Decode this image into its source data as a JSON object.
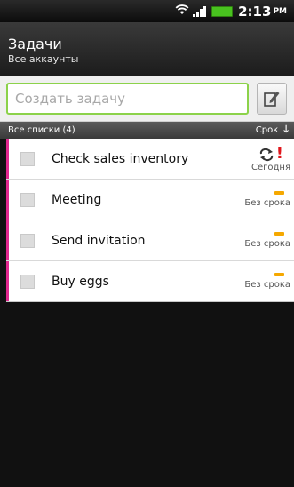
{
  "status_bar": {
    "time": "2:13",
    "ampm": "PM"
  },
  "header": {
    "title": "Задачи",
    "subtitle": "Все аккаунты"
  },
  "new_task": {
    "placeholder": "Создать задачу"
  },
  "list_header": {
    "label": "Все списки (4)",
    "sort_label": "Срок",
    "sort_arrow": "🡓"
  },
  "tasks": [
    {
      "title": "Check sales inventory",
      "due": "Сегодня",
      "priority": "high",
      "repeat": true
    },
    {
      "title": "Meeting",
      "due": "Без срока"
    },
    {
      "title": "Send invitation",
      "due": "Без срока"
    },
    {
      "title": "Buy eggs",
      "due": "Без срока"
    }
  ],
  "colors": {
    "accent_green": "#8cd24a",
    "list_marker": "#e1288f",
    "priority_normal": "#f5a800",
    "priority_high": "#e0161c"
  }
}
